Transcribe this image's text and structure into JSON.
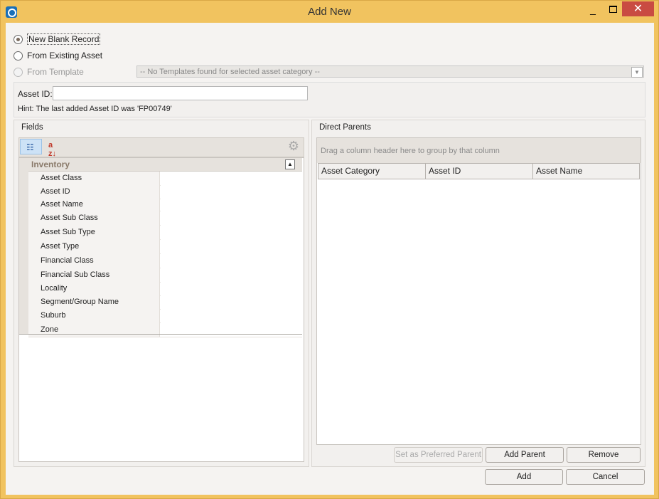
{
  "window": {
    "title": "Add New",
    "minimize_glyph": "_",
    "close_glyph": "✕"
  },
  "source_options": [
    {
      "label": "New Blank Record",
      "checked": true,
      "enabled": true
    },
    {
      "label": "From Existing Asset",
      "checked": false,
      "enabled": true
    },
    {
      "label": "From Template",
      "checked": false,
      "enabled": false
    }
  ],
  "template_combo": {
    "value": "-- No Templates found for selected asset category --"
  },
  "asset_id": {
    "label": "Asset ID:",
    "value": "",
    "hint": "Hint: The last added Asset ID was 'FP00749'"
  },
  "fields": {
    "title": "Fields",
    "category": "Inventory",
    "properties": [
      {
        "name": "Asset Class",
        "value": ""
      },
      {
        "name": "Asset ID",
        "value": ""
      },
      {
        "name": "Asset Name",
        "value": ""
      },
      {
        "name": "Asset Sub Class",
        "value": ""
      },
      {
        "name": "Asset Sub Type",
        "value": ""
      },
      {
        "name": "Asset Type",
        "value": ""
      },
      {
        "name": "Financial Class",
        "value": ""
      },
      {
        "name": "Financial Sub Class",
        "value": ""
      },
      {
        "name": "Locality",
        "value": ""
      },
      {
        "name": "Segment/Group Name",
        "value": ""
      },
      {
        "name": "Suburb",
        "value": ""
      },
      {
        "name": "Zone",
        "value": ""
      }
    ],
    "toolbar_icons": [
      "categorized-view-icon",
      "sort-alphabetical-icon",
      "gear-icon"
    ]
  },
  "parents": {
    "title": "Direct Parents",
    "group_hint": "Drag a column header here to group by that column",
    "columns": [
      "Asset Category",
      "Asset ID",
      "Asset Name"
    ],
    "rows": [],
    "buttons": {
      "preferred": "Set as Preferred Parent",
      "add": "Add Parent",
      "remove": "Remove"
    }
  },
  "footer": {
    "add": "Add",
    "cancel": "Cancel"
  }
}
